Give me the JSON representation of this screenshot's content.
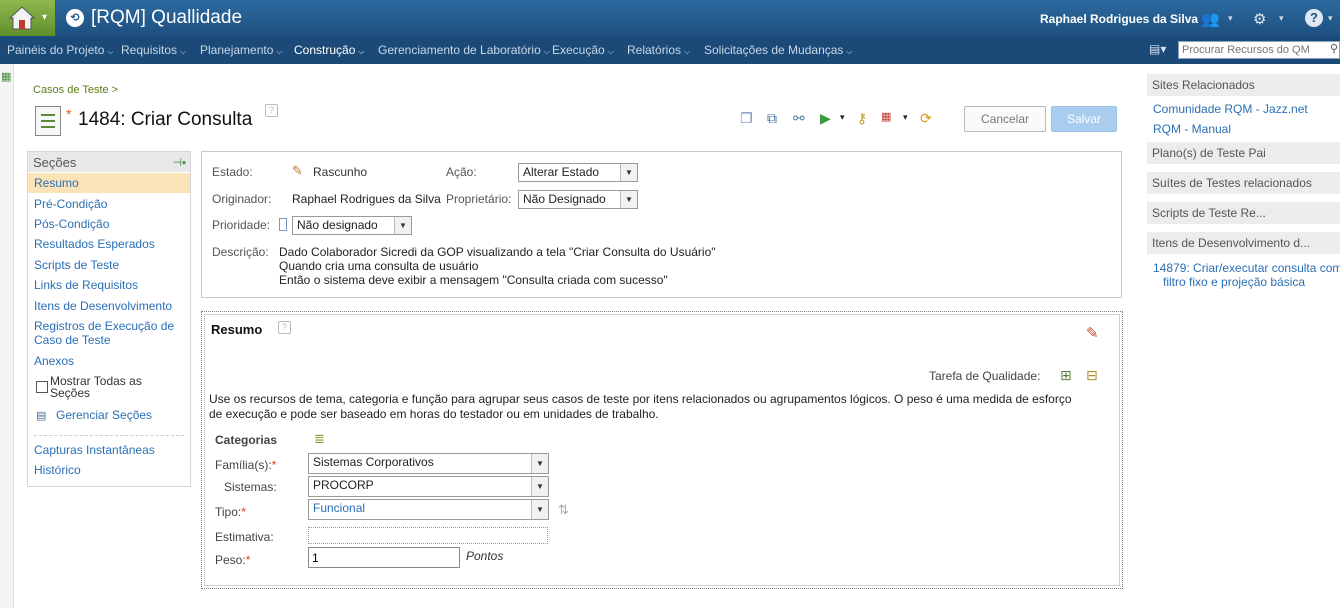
{
  "app": {
    "title": "[RQM] Quallidade",
    "user": "Raphael Rodrigues da Silva"
  },
  "menu": [
    {
      "label": "Painéis do Projeto"
    },
    {
      "label": "Requisitos"
    },
    {
      "label": "Planejamento"
    },
    {
      "label": "Construção"
    },
    {
      "label": "Gerenciamento de Laboratório"
    },
    {
      "label": "Execução"
    },
    {
      "label": "Relatórios"
    },
    {
      "label": "Solicitações de Mudanças"
    }
  ],
  "search": {
    "placeholder": "Procurar Recursos do QM"
  },
  "breadcrumb": "Casos de Teste >",
  "page": {
    "title": "1484: Criar Consulta",
    "modified_marker": "*"
  },
  "buttons": {
    "cancel": "Cancelar",
    "save": "Salvar"
  },
  "sections": {
    "heading": "Seções",
    "items": [
      "Resumo",
      "Pré-Condição",
      "Pós-Condição",
      "Resultados Esperados",
      "Scripts de Teste",
      "Links de Requisitos",
      "Itens de Desenvolvimento",
      "Registros de Execução de Caso de Teste",
      "Anexos"
    ],
    "show_all": "Mostrar Todas as Seções",
    "manage": "Gerenciar Seções",
    "snapshots": "Capturas Instantâneas",
    "history": "Histórico"
  },
  "info": {
    "estado_label": "Estado:",
    "estado_value": "Rascunho",
    "acao_label": "Ação:",
    "acao_value": "Alterar Estado",
    "originador_label": "Originador:",
    "originador_value": "Raphael Rodrigues da Silva",
    "proprietario_label": "Proprietário:",
    "proprietario_value": "Não Designado",
    "prioridade_label": "Prioridade:",
    "prioridade_value": "Não designado",
    "descricao_label": "Descrição:",
    "descricao_lines": [
      "Dado Colaborador Sicredi da GOP visualizando a tela \"Criar Consulta do Usuário\"",
      "Quando cria uma consulta de usuário",
      "Então o sistema deve exibir a mensagem \"Consulta criada com sucesso\""
    ]
  },
  "resumo": {
    "title": "Resumo",
    "tarefa_label": "Tarefa de Qualidade:",
    "text_lines": [
      "Use os recursos de tema, categoria e função para agrupar seus casos de teste por itens relacionados ou agrupamentos lógicos. O peso é uma medida de esforço",
      "de execução e pode ser baseado em horas do testador ou em unidades de trabalho."
    ],
    "categorias": "Categorias",
    "familia_label": "Família(s):",
    "familia_value": "Sistemas Corporativos",
    "sistemas_label": "Sistemas:",
    "sistemas_value": "PROCORP",
    "tipo_label": "Tipo:",
    "tipo_value": "Funcional",
    "estimativa_label": "Estimativa:",
    "estimativa_value": "",
    "peso_label": "Peso:",
    "peso_value": "1",
    "peso_unit": "Pontos",
    "req_marker": "*"
  },
  "right": {
    "sites_head": "Sites Relacionados",
    "site_links": [
      "Comunidade RQM - Jazz.net",
      "RQM - Manual"
    ],
    "plano_head": "Plano(s) de Teste Pai",
    "suites_head": "Suítes de Testes relacionados",
    "scripts_head": "Scripts de Teste Re...",
    "itens_head": "Itens de Desenvolvimento d...",
    "itens_link_lines": [
      "14879: Criar/executar consulta com",
      "filtro fixo e projeção básica"
    ]
  }
}
